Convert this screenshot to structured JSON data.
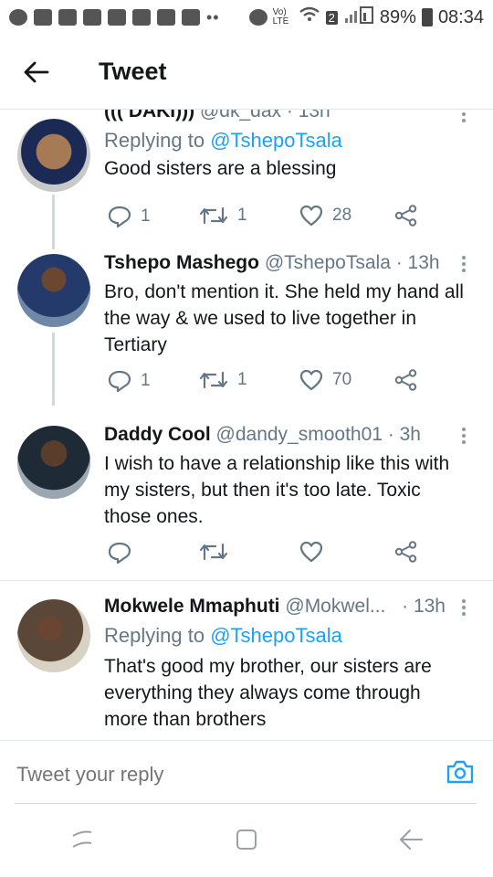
{
  "status_bar": {
    "battery": "89%",
    "time": "08:34",
    "volte": "Vo) LTE",
    "sim": "2"
  },
  "app_bar": {
    "title": "Tweet"
  },
  "tweets": [
    {
      "name": "((( DAKI)))",
      "handle": "@dk_dax",
      "time": "13h",
      "replying_label": "Replying to",
      "replying_to": "@TshepoTsala",
      "text": "Good sisters are a blessing",
      "replies": "1",
      "retweets": "1",
      "likes": "28"
    },
    {
      "name": "Tshepo Mashego",
      "handle": "@TshepoTsala",
      "time": "13h",
      "text": "Bro, don't mention it. She held my hand all the way & we used to live together in Tertiary",
      "replies": "1",
      "retweets": "1",
      "likes": "70"
    },
    {
      "name": "Daddy Cool",
      "handle": "@dandy_smooth01",
      "time": "3h",
      "text": "I wish to have a relationship like this with my sisters, but then it's too late. Toxic those ones.",
      "replies": "",
      "retweets": "",
      "likes": ""
    },
    {
      "name": "Mokwele Mmaphuti",
      "handle": "@Mokwel...",
      "time": "13h",
      "replying_label": "Replying to",
      "replying_to": "@TshepoTsala",
      "text": "That's good my brother, our sisters are everything they always come through more than brothers"
    }
  ],
  "reply_box": {
    "placeholder": "Tweet your reply"
  },
  "colors": {
    "accent": "#1da1f2",
    "secondary_text": "#657786",
    "divider": "#e1e8ed"
  }
}
